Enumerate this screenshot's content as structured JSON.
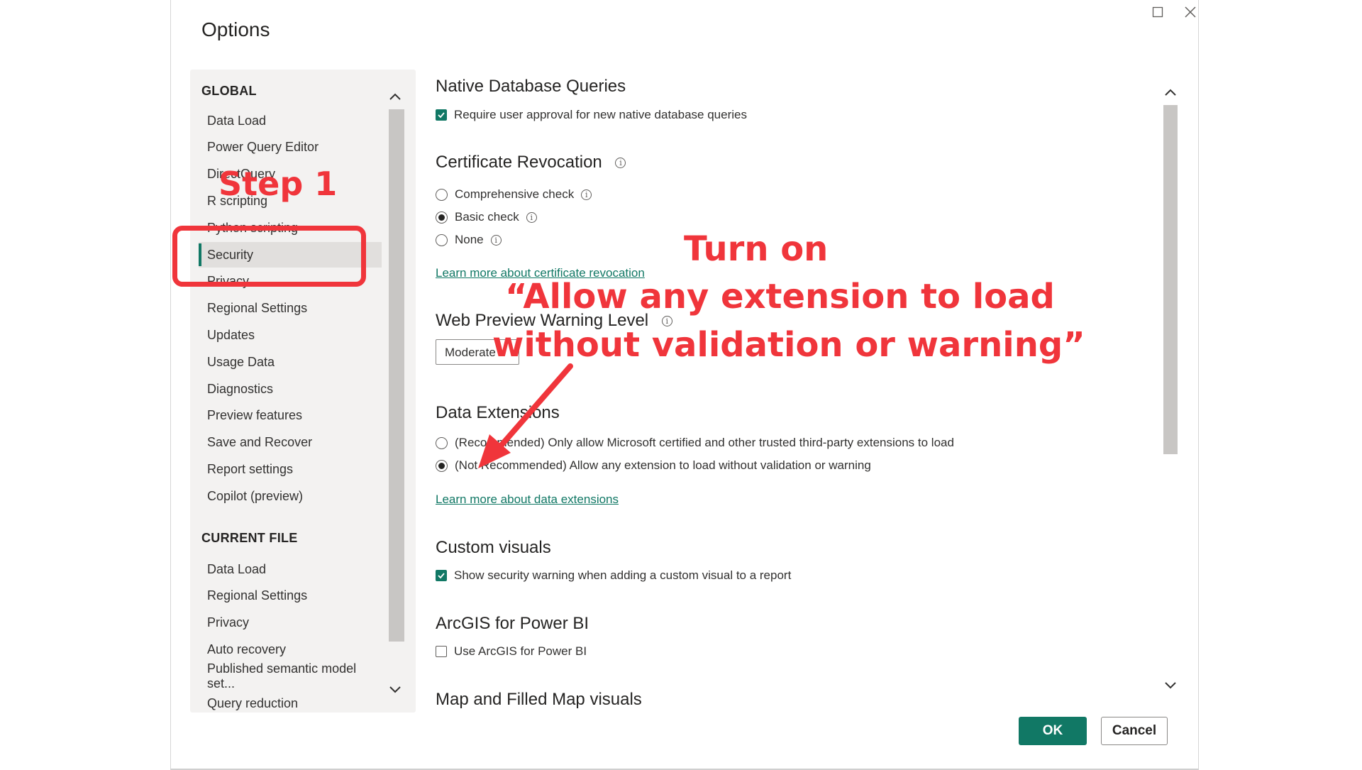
{
  "window": {
    "title": "Options",
    "maximize_icon": "maximize-icon",
    "close_icon": "close-icon"
  },
  "nav": {
    "global_header": "GLOBAL",
    "global_items": [
      {
        "label": "Data Load"
      },
      {
        "label": "Power Query Editor"
      },
      {
        "label": "DirectQuery"
      },
      {
        "label": "R scripting"
      },
      {
        "label": "Python scripting"
      },
      {
        "label": "Security",
        "selected": true
      },
      {
        "label": "Privacy"
      },
      {
        "label": "Regional Settings"
      },
      {
        "label": "Updates"
      },
      {
        "label": "Usage Data"
      },
      {
        "label": "Diagnostics"
      },
      {
        "label": "Preview features"
      },
      {
        "label": "Save and Recover"
      },
      {
        "label": "Report settings"
      },
      {
        "label": "Copilot (preview)"
      }
    ],
    "current_file_header": "CURRENT FILE",
    "current_file_items": [
      {
        "label": "Data Load"
      },
      {
        "label": "Regional Settings"
      },
      {
        "label": "Privacy"
      },
      {
        "label": "Auto recovery"
      },
      {
        "label": "Published semantic model set..."
      },
      {
        "label": "Query reduction"
      }
    ]
  },
  "content": {
    "native_db": {
      "heading": "Native Database Queries",
      "require_approval": {
        "label": "Require user approval for new native database queries",
        "checked": true
      }
    },
    "cert_revocation": {
      "heading": "Certificate Revocation",
      "options": [
        {
          "label": "Comprehensive check",
          "selected": false
        },
        {
          "label": "Basic check",
          "selected": true
        },
        {
          "label": "None",
          "selected": false
        }
      ],
      "learn_more": "Learn more about certificate revocation"
    },
    "web_preview": {
      "heading": "Web Preview Warning Level",
      "value": "Moderate"
    },
    "data_extensions": {
      "heading": "Data Extensions",
      "options": [
        {
          "label": "(Recommended) Only allow Microsoft certified and other trusted third-party extensions to load",
          "selected": false
        },
        {
          "label": "(Not Recommended) Allow any extension to load without validation or warning",
          "selected": true
        }
      ],
      "learn_more": "Learn more about data extensions"
    },
    "custom_visuals": {
      "heading": "Custom visuals",
      "show_warning": {
        "label": "Show security warning when adding a custom visual to a report",
        "checked": true
      }
    },
    "arcgis": {
      "heading": "ArcGIS for Power BI",
      "use_arcgis": {
        "label": "Use ArcGIS for Power BI",
        "checked": false
      }
    },
    "map_visuals": {
      "heading": "Map and Filled Map visuals"
    }
  },
  "buttons": {
    "ok": "OK",
    "cancel": "Cancel"
  },
  "annotations": {
    "step1": "Step 1",
    "turn_on_line1": "Turn on",
    "turn_on_line2": "“Allow any extension to load",
    "turn_on_line3": "without validation or warning”",
    "color": "#f0353b"
  },
  "colors": {
    "accent": "#117865",
    "nav_bg": "#f3f2f1"
  }
}
